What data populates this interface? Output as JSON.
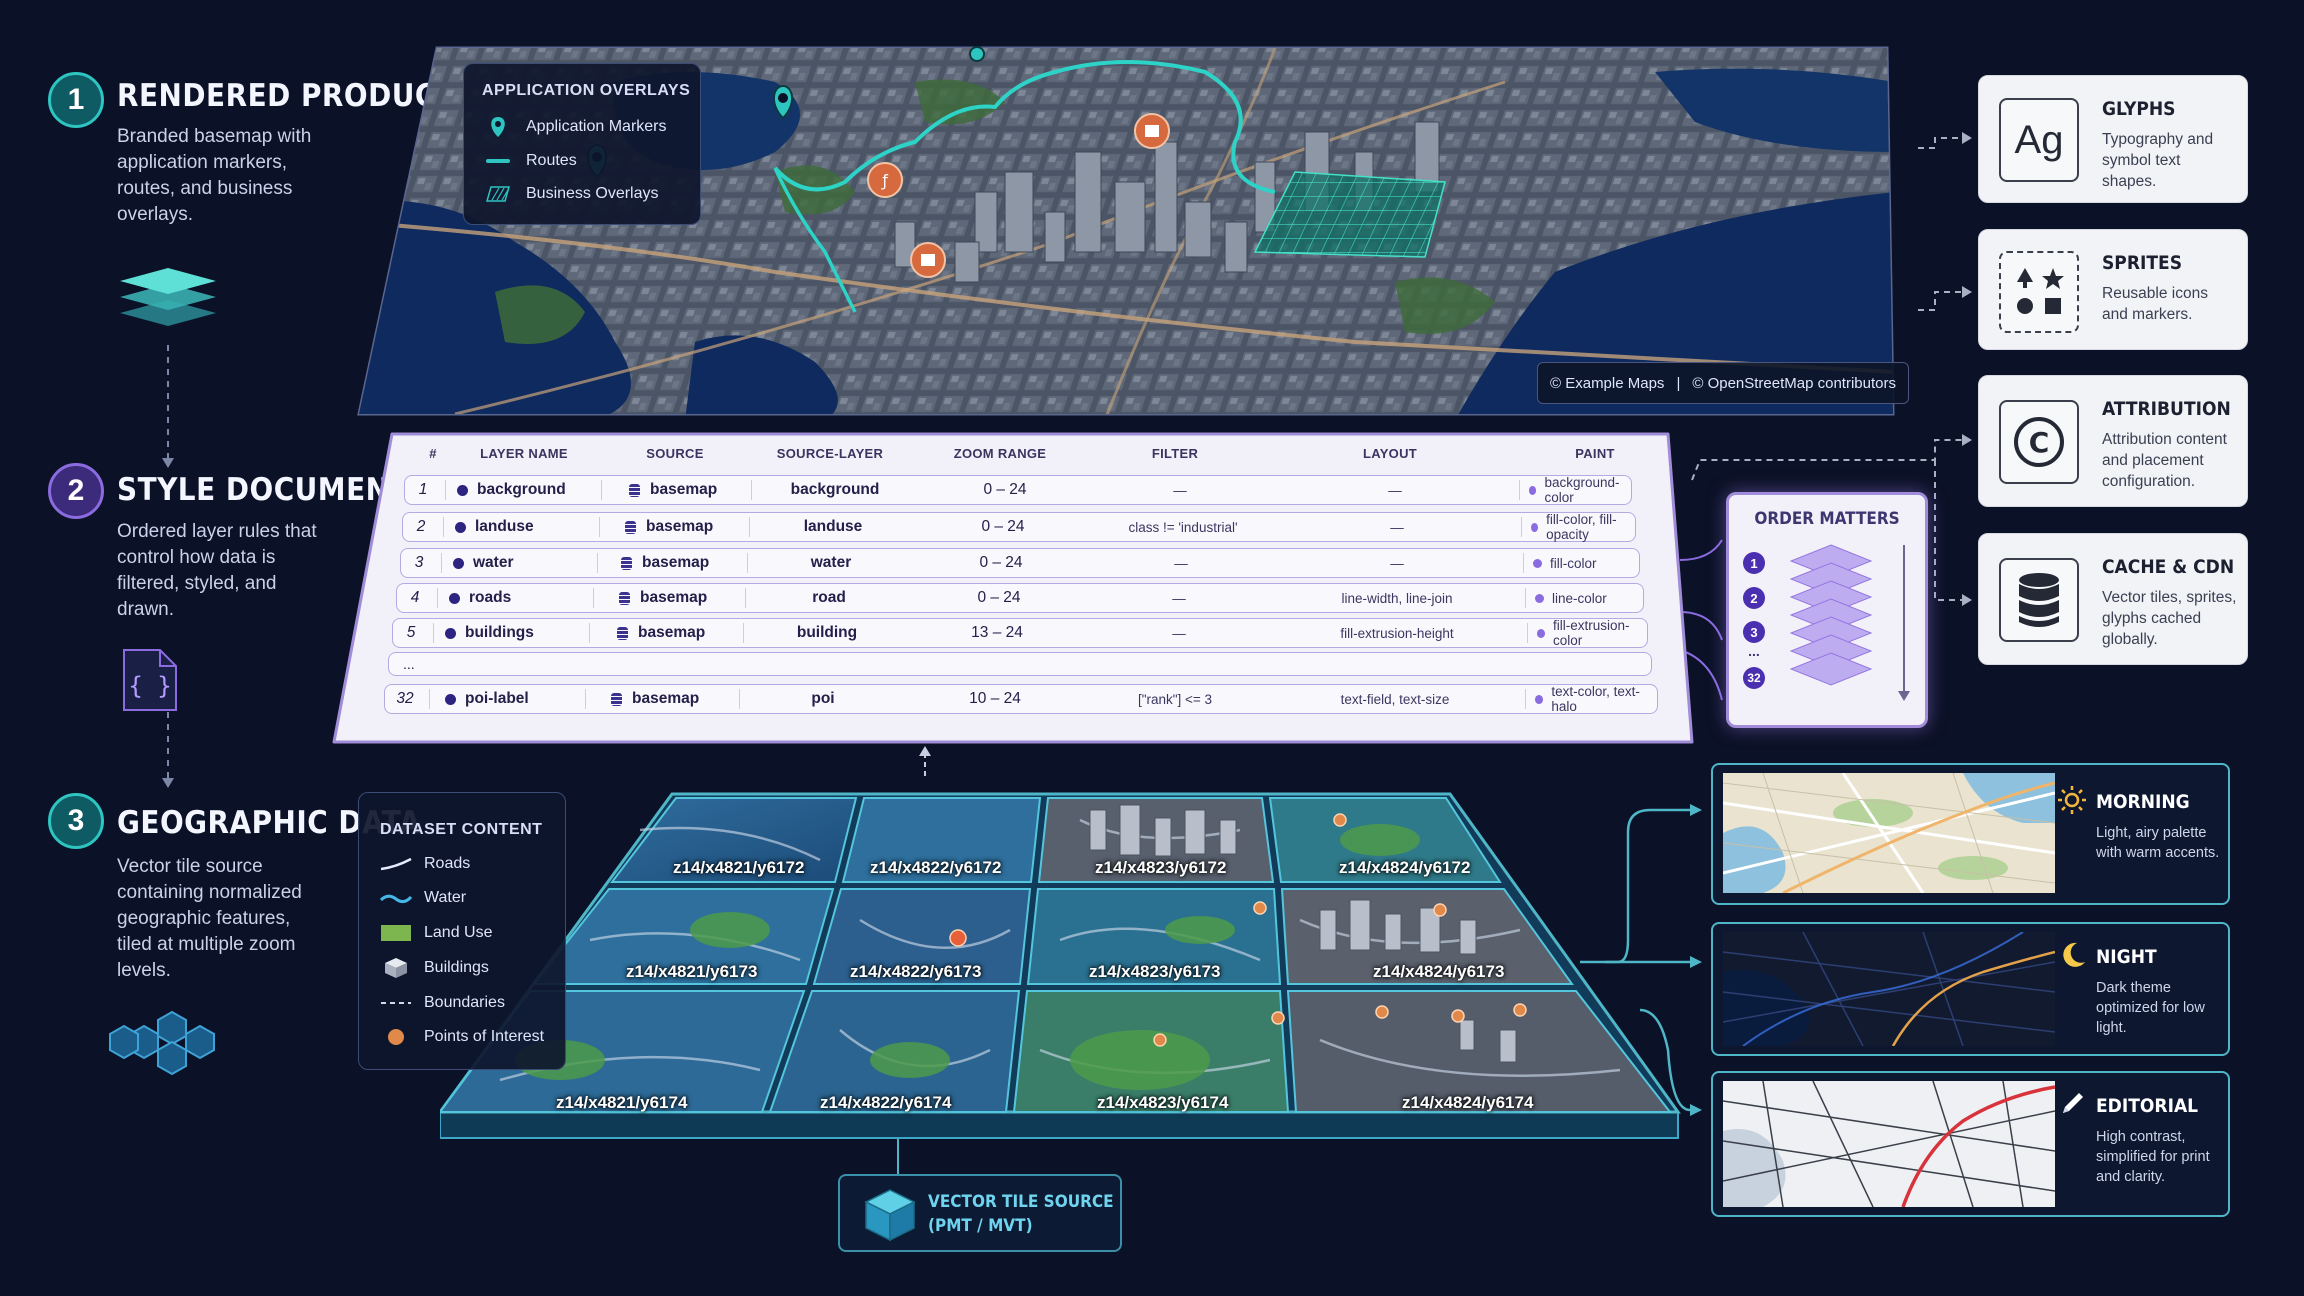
{
  "steps": [
    {
      "num": "1",
      "title": "RENDERED PRODUCT",
      "desc": "Branded basemap with application markers, routes, and business overlays."
    },
    {
      "num": "2",
      "title": "STYLE DOCUMENT",
      "desc": "Ordered layer rules that control how data is filtered, styled, and drawn."
    },
    {
      "num": "3",
      "title": "GEOGRAPHIC DATA",
      "desc": "Vector tile source containing normalized geographic features, tiled at multiple zoom levels."
    }
  ],
  "app_overlays": {
    "title": "APPLICATION OVERLAYS",
    "items": [
      {
        "label": "Application Markers",
        "icon": "map-pin-icon"
      },
      {
        "label": "Routes",
        "icon": "route-line-icon"
      },
      {
        "label": "Business Overlays",
        "icon": "hatched-area-icon"
      }
    ]
  },
  "attribution": {
    "text1": "© Example Maps",
    "divider": "|",
    "text2": "© OpenStreetMap contributors"
  },
  "style_table": {
    "headers": [
      "#",
      "LAYER NAME",
      "SOURCE",
      "SOURCE-LAYER",
      "ZOOM RANGE",
      "FILTER",
      "LAYOUT",
      "PAINT"
    ],
    "rows": [
      {
        "num": "1",
        "name": "background",
        "source": "basemap",
        "source_layer": "background",
        "zoom": "0 – 24",
        "filter": "—",
        "layout": "—",
        "paint": "background-color"
      },
      {
        "num": "2",
        "name": "landuse",
        "source": "basemap",
        "source_layer": "landuse",
        "zoom": "0 – 24",
        "filter": "class != 'industrial'",
        "layout": "—",
        "paint": "fill-color, fill-opacity"
      },
      {
        "num": "3",
        "name": "water",
        "source": "basemap",
        "source_layer": "water",
        "zoom": "0 – 24",
        "filter": "—",
        "layout": "—",
        "paint": "fill-color"
      },
      {
        "num": "4",
        "name": "roads",
        "source": "basemap",
        "source_layer": "road",
        "zoom": "0 – 24",
        "filter": "—",
        "layout": "line-width, line-join",
        "paint": "line-color"
      },
      {
        "num": "5",
        "name": "buildings",
        "source": "basemap",
        "source_layer": "building",
        "zoom": "13 – 24",
        "filter": "—",
        "layout": "fill-extrusion-height",
        "paint": "fill-extrusion-color"
      }
    ],
    "ellipsis": "...",
    "last_row": {
      "num": "32",
      "name": "poi-label",
      "source": "basemap",
      "source_layer": "poi",
      "zoom": "10 – 24",
      "filter": "[\"rank\"] <= 3",
      "layout": "text-field, text-size",
      "paint": "text-color, text-halo"
    }
  },
  "order_matters": {
    "title": "ORDER MATTERS",
    "numbers": [
      "1",
      "2",
      "3",
      "...",
      "32"
    ]
  },
  "resource_cards": [
    {
      "title": "GLYPHS",
      "desc": "Typography and symbol text shapes.",
      "icon": "glyphs-ag-icon",
      "icon_text": "Ag"
    },
    {
      "title": "SPRITES",
      "desc": "Reusable icons and markers.",
      "icon": "sprites-icon",
      "icon_text": ""
    },
    {
      "title": "ATTRIBUTION",
      "desc": "Attribution content and placement configuration.",
      "icon": "copyright-icon",
      "icon_text": "©"
    },
    {
      "title": "CACHE & CDN",
      "desc": "Vector tiles, sprites, glyphs cached globally.",
      "icon": "database-icon",
      "icon_text": ""
    }
  ],
  "dataset_content": {
    "title": "DATASET CONTENT",
    "items": [
      {
        "label": "Roads",
        "icon": "road-line-icon"
      },
      {
        "label": "Water",
        "icon": "water-wave-icon"
      },
      {
        "label": "Land Use",
        "icon": "land-use-swatch-icon"
      },
      {
        "label": "Buildings",
        "icon": "building-cube-icon"
      },
      {
        "label": "Boundaries",
        "icon": "boundary-dash-icon"
      },
      {
        "label": "Points of Interest",
        "icon": "poi-dot-icon"
      }
    ]
  },
  "tiles": [
    [
      "z14/x4821/y6172",
      "z14/x4822/y6172",
      "z14/x4823/y6172",
      "z14/x4824/y6172"
    ],
    [
      "z14/x4821/y6173",
      "z14/x4822/y6173",
      "z14/x4823/y6173",
      "z14/x4824/y6173"
    ],
    [
      "z14/x4821/y6174",
      "z14/x4822/y6174",
      "z14/x4823/y6174",
      "z14/x4824/y6174"
    ]
  ],
  "vector_source": {
    "line1": "VECTOR TILE SOURCE",
    "line2": "(PMT / MVT)"
  },
  "themes": [
    {
      "title": "MORNING",
      "desc": "Light, airy palette with warm accents.",
      "icon": "sun-icon"
    },
    {
      "title": "NIGHT",
      "desc": "Dark theme optimized for low light.",
      "icon": "moon-icon"
    },
    {
      "title": "EDITORIAL",
      "desc": "High contrast, simplified for print and clarity.",
      "icon": "pencil-icon"
    }
  ],
  "colors": {
    "bg": "#0b1126",
    "teal": "#2ec4c0",
    "purple": "#8a6be0",
    "orange": "#e07a45",
    "cyan_border": "#4fb6c8"
  }
}
